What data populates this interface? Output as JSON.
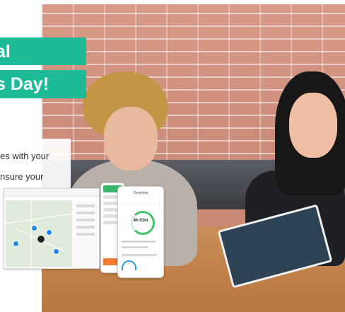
{
  "banner": {
    "line1": "al",
    "line2": "s Day!"
  },
  "body_text": {
    "line1": "es with your",
    "line2": "nsure your"
  },
  "mobile": {
    "title": "Overview",
    "time": "4h 01m"
  }
}
